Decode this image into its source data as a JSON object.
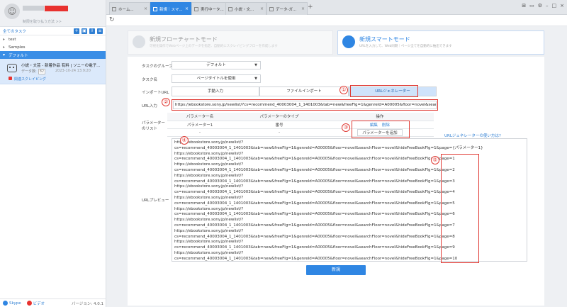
{
  "sidebar": {
    "promo": "制限を取り払う方法 >>",
    "all_tasks": "全てのタスク",
    "toolbar_icons": [
      "new-task-icon",
      "new-folder-icon",
      "import-icon",
      "settings-icon"
    ],
    "tree": [
      {
        "label": "test",
        "icon": "folder-icon"
      },
      {
        "label": "Samples",
        "icon": "folder-icon"
      },
      {
        "label": "デフォルト",
        "icon": "folder-open-icon"
      }
    ],
    "task": {
      "title": "小説・文芸 - 新着作品 有料 | ソニーの電子...",
      "data_label": "データ数:",
      "data_count": "82",
      "date": "2023-10-24 13:9:20",
      "link": "関連スクレイピング"
    },
    "footer": {
      "link1": "Skype",
      "link2": "ビデオ",
      "version": "バージョン: 4.0.1"
    }
  },
  "tabs": [
    {
      "label": "ホーム...",
      "active": false
    },
    {
      "label": "新規｜スマ...",
      "active": true
    },
    {
      "label": "実行中ータ...",
      "active": false
    },
    {
      "label": "小説・文...",
      "active": false
    },
    {
      "label": "データ-ガ...",
      "active": false
    }
  ],
  "modes": {
    "flow": {
      "title": "新規フローチャートモード",
      "desc": "可視化操作でWebページ上のデータを指定、自動的にスクレイピングフローを作成します"
    },
    "smart": {
      "title": "新規スマートモード",
      "desc": "URLを入力して、Web同期｜ページ全てを自動的に抽出できます"
    }
  },
  "form": {
    "group_label": "タスクのグループ",
    "group_value": "デフォルト",
    "name_label": "タスク名",
    "name_value": "ページタイトルを使用",
    "import_label": "インポートURL",
    "import_options": [
      "手動入力",
      "ファイルインポート",
      "URLジェネレーター"
    ],
    "url_label": "URL入力",
    "url_value": "https://ebookstore.sony.jp/newlist/?cs=recommend_40003004_1_1401003&tab=new&freeFlg=1&genreId=A00005&floor=novel&searchFloor=novel&hideFreeBookFlg=1",
    "param_label": "パラメーターのリスト",
    "param_headers": [
      "パラメーター名",
      "パラメーターのタイプ",
      "操作"
    ],
    "param_row": [
      "パラメーター1",
      "番号"
    ],
    "param_ops": [
      "編集",
      "削除"
    ],
    "param_empty": [
      "-",
      "-"
    ],
    "add_param": "パラメーターを追加",
    "help_link": "URLジェネレーターの使い方は?",
    "preview_label": "URLプレビュー",
    "preview_lines": [
      "https://ebookstore.sony.jp/newlist/?",
      "cs=recommend_40003004_1_1401003&tab=new&freeFlg=1&genreId=A00005&floor=novel&searchFloor=novel&hideFreeBookFlg=1&page={パラメーター1}",
      "https://ebookstore.sony.jp/newlist/?",
      "cs=recommend_40003004_1_1401003&tab=new&freeFlg=1&genreId=A00005&floor=novel&searchFloor=novel&hideFreeBookFlg=1&page=1",
      "https://ebookstore.sony.jp/newlist/?",
      "cs=recommend_40003004_1_1401003&tab=new&freeFlg=1&genreId=A00005&floor=novel&searchFloor=novel&hideFreeBookFlg=1&page=2",
      "https://ebookstore.sony.jp/newlist/?",
      "cs=recommend_40003004_1_1401003&tab=new&freeFlg=1&genreId=A00005&floor=novel&searchFloor=novel&hideFreeBookFlg=1&page=3",
      "https://ebookstore.sony.jp/newlist/?",
      "cs=recommend_40003004_1_1401003&tab=new&freeFlg=1&genreId=A00005&floor=novel&searchFloor=novel&hideFreeBookFlg=1&page=4",
      "https://ebookstore.sony.jp/newlist/?",
      "cs=recommend_40003004_1_1401003&tab=new&freeFlg=1&genreId=A00005&floor=novel&searchFloor=novel&hideFreeBookFlg=1&page=5",
      "https://ebookstore.sony.jp/newlist/?",
      "cs=recommend_40003004_1_1401003&tab=new&freeFlg=1&genreId=A00005&floor=novel&searchFloor=novel&hideFreeBookFlg=1&page=6",
      "https://ebookstore.sony.jp/newlist/?",
      "cs=recommend_40003004_1_1401003&tab=new&freeFlg=1&genreId=A00005&floor=novel&searchFloor=novel&hideFreeBookFlg=1&page=7",
      "https://ebookstore.sony.jp/newlist/?",
      "cs=recommend_40003004_1_1401003&tab=new&freeFlg=1&genreId=A00005&floor=novel&searchFloor=novel&hideFreeBookFlg=1&page=8",
      "https://ebookstore.sony.jp/newlist/?",
      "cs=recommend_40003004_1_1401003&tab=new&freeFlg=1&genreId=A00005&floor=novel&searchFloor=novel&hideFreeBookFlg=1&page=9",
      "https://ebookstore.sony.jp/newlist/?",
      "cs=recommend_40003004_1_1401003&tab=new&freeFlg=1&genreId=A00005&floor=novel&searchFloor=novel&hideFreeBookFlg=1&page=10"
    ],
    "create_button": "新規"
  },
  "annotations": [
    "①",
    "②",
    "③",
    "④",
    "⑤"
  ],
  "colors": {
    "accent": "#2f86e3",
    "annotation": "#e03a34",
    "brand_red": "#e8322f"
  }
}
